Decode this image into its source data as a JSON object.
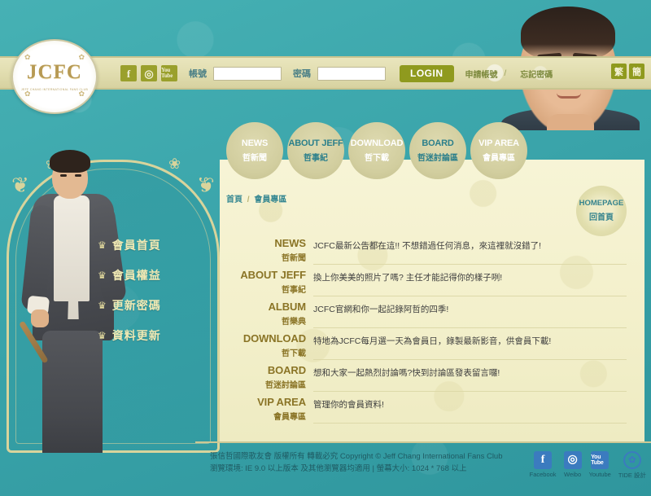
{
  "site": {
    "logo_mark": "JCFC",
    "logo_subtitle": "JEFF CHANG INTERNATIONAL FANS CLUB"
  },
  "header": {
    "social": [
      {
        "name": "facebook-icon",
        "glyph": "f"
      },
      {
        "name": "weibo-icon",
        "glyph": "◎"
      },
      {
        "name": "youtube-icon",
        "glyph": "You Tube"
      }
    ],
    "account_label": "帳號",
    "account_value": "",
    "account_placeholder": "",
    "password_label": "密碼",
    "password_value": "",
    "password_placeholder": "",
    "login_button": "LOGIN",
    "register_link": "申請帳號",
    "link_separator": "/",
    "forgot_link": "忘記密碼",
    "lang_traditional": "繁",
    "lang_simplified": "簡"
  },
  "nav": [
    {
      "en": "NEWS",
      "cn": "哲新聞",
      "style": "light"
    },
    {
      "en": "ABOUT JEFF",
      "cn": "哲事紀",
      "style": "dark"
    },
    {
      "en": "DOWNLOAD",
      "cn": "哲下載",
      "style": "light"
    },
    {
      "en": "BOARD",
      "cn": "哲迷討論區",
      "style": "dark"
    },
    {
      "en": "VIP AREA",
      "cn": "會員專區",
      "style": "light"
    }
  ],
  "sidebar": {
    "items": [
      {
        "icon": "crown-icon",
        "label": "會員首頁"
      },
      {
        "icon": "crown-icon",
        "label": "會員權益"
      },
      {
        "icon": "crown-icon",
        "label": "更新密碼"
      },
      {
        "icon": "crown-icon",
        "label": "資料更新"
      }
    ]
  },
  "main": {
    "breadcrumb_home": "首頁",
    "breadcrumb_separator": "/",
    "breadcrumb_current": "會員專區",
    "homepage_badge_en": "HOMEPAGE",
    "homepage_badge_cn": "回首頁",
    "rows": [
      {
        "en": "NEWS",
        "cn": "哲新聞",
        "desc": "JCFC最新公告都在這!! 不想錯過任何消息，來這裡就沒錯了!"
      },
      {
        "en": "ABOUT JEFF",
        "cn": "哲事紀",
        "desc": "換上你美美的照片了嗎? 主任才能記得你的樣子咧!"
      },
      {
        "en": "ALBUM",
        "cn": "哲樂典",
        "desc": "JCFC官網和你一起記錄阿哲的四季!"
      },
      {
        "en": "DOWNLOAD",
        "cn": "哲下載",
        "desc": "特地為JCFC每月選一天為會員日，錄製最新影音，供會員下載!"
      },
      {
        "en": "BOARD",
        "cn": "哲迷討論區",
        "desc": "想和大家一起熱烈討論嗎?快到討論區發表留言囉!"
      },
      {
        "en": "VIP AREA",
        "cn": "會員專區",
        "desc": "管理你的會員資料!"
      }
    ]
  },
  "footer": {
    "copyright": "張信哲國際歌友會 版權所有 轉載必究 Copyright © Jeff Chang International Fans Club",
    "browser_note": "瀏覽環境: IE 9.0 以上版本 及其他瀏覽器均適用 | 螢幕大小: 1024 * 768 以上",
    "social": [
      {
        "icon": "facebook-icon",
        "glyph": "f",
        "label": "Facebook"
      },
      {
        "icon": "weibo-icon",
        "glyph": "◎",
        "label": "Weibo"
      },
      {
        "icon": "youtube-icon",
        "glyph": "You Tube",
        "label": "Youtube"
      },
      {
        "icon": "studio-credit-icon",
        "glyph": "✿",
        "label": "TIDE 設計"
      }
    ]
  },
  "colors": {
    "teal": "#3fa9ae",
    "cream": "#f5f2cd",
    "gold": "#8a7426",
    "olive": "#8f9a1e",
    "band": "#e3dfb2"
  }
}
